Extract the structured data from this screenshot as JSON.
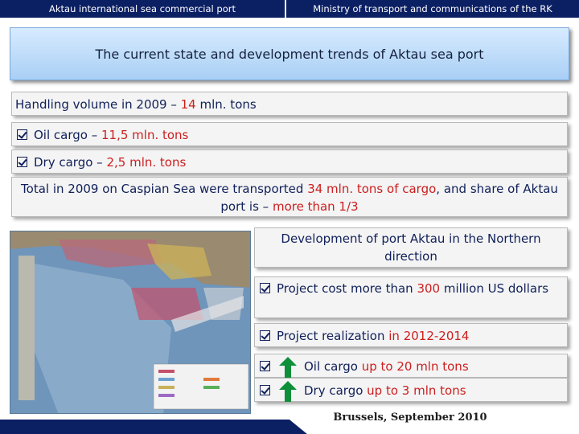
{
  "header": {
    "left_text": "Aktau international sea commercial port",
    "right_text": "Ministry of transport and communications of the RK"
  },
  "title": "The current state and development trends of Aktau sea port",
  "handling": {
    "prefix": "Handling volume in 2009 – ",
    "value": "14",
    "suffix": " mln. tons"
  },
  "oil_cargo": {
    "prefix": "Oil cargo – ",
    "value": "11,5",
    "suffix": " mln. tons"
  },
  "dry_cargo": {
    "prefix": "Dry cargo – ",
    "value": "2,5",
    "suffix": " mln. tons"
  },
  "total": {
    "part1": "Total in 2009 on Caspian Sea were transported ",
    "value": "34",
    "part2": " mln. tons of cargo",
    "part3": ", and share of Aktau port is – ",
    "share": "more than 1/3"
  },
  "development": {
    "title": "Development of port Aktau in the Northern direction"
  },
  "project_cost": {
    "prefix": "Project cost more than ",
    "value": "300",
    "suffix": " million US dollars"
  },
  "project_realization": {
    "prefix": "Project realization ",
    "value": "in 2012-2014"
  },
  "oil_target": {
    "prefix": "Oil cargo ",
    "value": "up to 20 mln tons"
  },
  "dry_target": {
    "prefix": "Dry cargo ",
    "value": "up to 3 mln tons"
  },
  "footer": "Brussels, September 2010",
  "colors": {
    "navy": "#0b1f63",
    "accent_red": "#cc1f1f",
    "arrow_green": "#0f8f3a",
    "title_blue": "#a9cff5"
  },
  "icons": {
    "check": "checkbox-checked-icon",
    "up": "green-up-arrow-icon"
  }
}
